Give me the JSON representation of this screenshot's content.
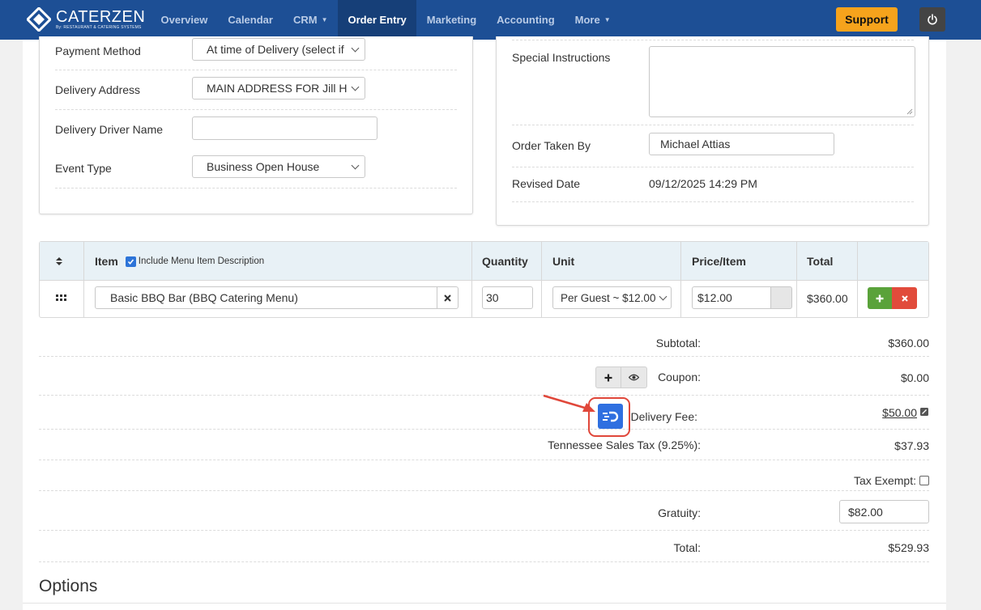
{
  "nav": {
    "logo_name": "CATERZEN",
    "logo_sub": "By: RESTAURANT & CATERING SYSTEMS",
    "items": [
      {
        "label": "Overview",
        "caret": ""
      },
      {
        "label": "Calendar",
        "caret": ""
      },
      {
        "label": "CRM",
        "caret": "▼"
      },
      {
        "label": "Order Entry",
        "caret": ""
      },
      {
        "label": "Marketing",
        "caret": ""
      },
      {
        "label": "Accounting",
        "caret": ""
      },
      {
        "label": "More",
        "caret": "▼"
      }
    ],
    "active": "Order Entry",
    "support_label": "Support",
    "power_icon": "power-icon",
    "accent_color": "#1d4f95"
  },
  "left_form": {
    "payment_method": {
      "label": "Payment Method",
      "value": "At time of Delivery (select if"
    },
    "delivery_address": {
      "label": "Delivery Address",
      "value": "MAIN ADDRESS FOR Jill H"
    },
    "driver_name": {
      "label": "Delivery Driver Name",
      "value": ""
    },
    "event_type": {
      "label": "Event Type",
      "value": "Business Open House"
    }
  },
  "right_form": {
    "special_instructions": {
      "label": "Special Instructions",
      "value": ""
    },
    "order_taken_by": {
      "label": "Order Taken By",
      "value": "Michael Attias"
    },
    "revised_date": {
      "label": "Revised Date",
      "value": "09/12/2025 14:29 PM"
    }
  },
  "items_table": {
    "headers": {
      "item": "Item",
      "include_desc": "Include Menu Item Description",
      "quantity": "Quantity",
      "unit": "Unit",
      "price": "Price/Item",
      "total": "Total"
    },
    "include_desc_checked": true,
    "rows": [
      {
        "item": "Basic BBQ Bar (BBQ Catering Menu)",
        "quantity": "30",
        "unit": "Per Guest ~ $12.00",
        "price": "$12.00",
        "total": "$360.00"
      }
    ]
  },
  "totals": {
    "subtotal": {
      "label": "Subtotal:",
      "value": "$360.00"
    },
    "coupon": {
      "label": "Coupon:",
      "value": "$0.00"
    },
    "delivery_fee": {
      "label": "Delivery Fee:",
      "value": "$50.00"
    },
    "tax": {
      "label": "Tennessee Sales Tax (9.25%):",
      "value": "$37.93"
    },
    "tax_exempt": {
      "label": "Tax Exempt:",
      "checked": false
    },
    "gratuity": {
      "label": "Gratuity:",
      "value": "$82.00"
    },
    "total": {
      "label": "Total:",
      "value": "$529.93"
    }
  },
  "options": {
    "heading": "Options"
  },
  "colors": {
    "support": "#f6a31c",
    "add_green": "#5aa23a",
    "remove_red": "#e14b3b",
    "doordash_blue": "#2f6fe0",
    "highlight_red": "#e0473a"
  }
}
